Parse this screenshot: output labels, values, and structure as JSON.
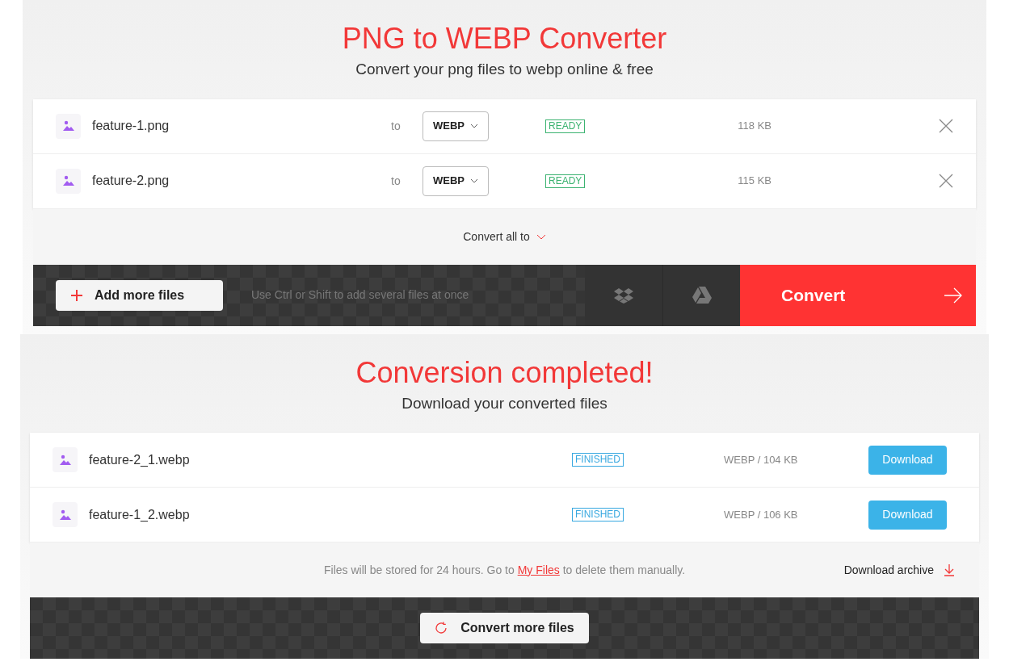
{
  "converter": {
    "title": "PNG to WEBP Converter",
    "subtitle": "Convert your png files to webp online & free",
    "files": [
      {
        "name": "feature-1.png",
        "to_label": "to",
        "format": "WEBP",
        "status": "READY",
        "size": "118 KB"
      },
      {
        "name": "feature-2.png",
        "to_label": "to",
        "format": "WEBP",
        "status": "READY",
        "size": "115 KB"
      }
    ],
    "convert_all": "Convert all to",
    "add_button": "Add more files",
    "hint": "Use Ctrl or Shift to add several files at once",
    "convert_button": "Convert"
  },
  "result": {
    "title": "Conversion completed!",
    "subtitle": "Download your converted files",
    "files": [
      {
        "name": "feature-2_1.webp",
        "status": "FINISHED",
        "size": "WEBP / 104 KB",
        "button": "Download"
      },
      {
        "name": "feature-1_2.webp",
        "status": "FINISHED",
        "size": "WEBP / 106 KB",
        "button": "Download"
      }
    ],
    "note": {
      "before": "Files will be stored for 24 hours. Go to",
      "link": "My Files",
      "after": "to delete them manually."
    },
    "archive": "Download archive",
    "more_button": "Convert more files"
  }
}
